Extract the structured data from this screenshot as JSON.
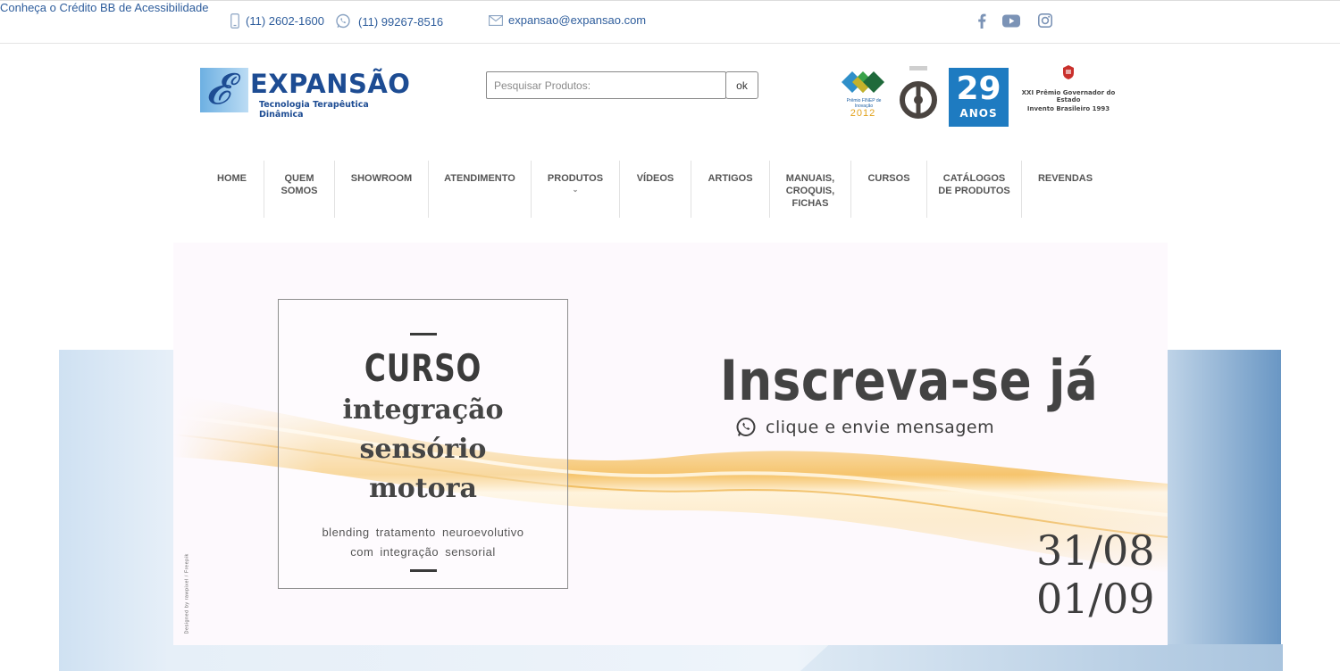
{
  "topbar": {
    "phone": "(11) 2602-1600",
    "whatsapp": "(11) 99267-8516",
    "email": "expansao@expansao.com",
    "accessibility_link": "Conheça o Crédito BB de Acessibilidade",
    "social": [
      "facebook-icon",
      "youtube-icon",
      "instagram-icon"
    ],
    "accent_color": "#2e5d9c"
  },
  "header": {
    "logo_name": "EXPANSÃO",
    "logo_tagline": "Tecnologia Terapêutica Dinâmica",
    "logo_color": "#1d4c93",
    "search_placeholder": "Pesquisar Produtos:",
    "search_button": "ok",
    "awards": {
      "finep_label": "Prêmio FINEP de Inovação",
      "finep_year": "2012",
      "anos_number": "29",
      "anos_label": "ANOS",
      "gov_line1": "XXI Prêmio Governador do Estado",
      "gov_line2": "Invento Brasileiro 1993"
    }
  },
  "nav": {
    "items": [
      {
        "label": "HOME"
      },
      {
        "label": "QUEM\nSOMOS"
      },
      {
        "label": "SHOWROOM"
      },
      {
        "label": "ATENDIMENTO"
      },
      {
        "label": "PRODUTOS",
        "has_dropdown": true
      },
      {
        "label": "VÍDEOS"
      },
      {
        "label": "ARTIGOS"
      },
      {
        "label": "MANUAIS,\nCROQUIS,\nFICHAS"
      },
      {
        "label": "CURSOS"
      },
      {
        "label": "CATÁLOGOS\nDE PRODUTOS"
      },
      {
        "label": "REVENDAS"
      }
    ]
  },
  "banner": {
    "course_heading": "CURSO",
    "course_subject": "integração\nsensório\nmotora",
    "course_description": "blending tratamento neuroevolutivo\ncom integração sensorial",
    "cta_title": "Inscreva-se já",
    "cta_subtitle": "clique e envie mensagem",
    "date_1": "31/08",
    "date_2": "01/09",
    "credit": "Designed by rawpixel / Freepik",
    "wave_color": "#f3b33d"
  }
}
